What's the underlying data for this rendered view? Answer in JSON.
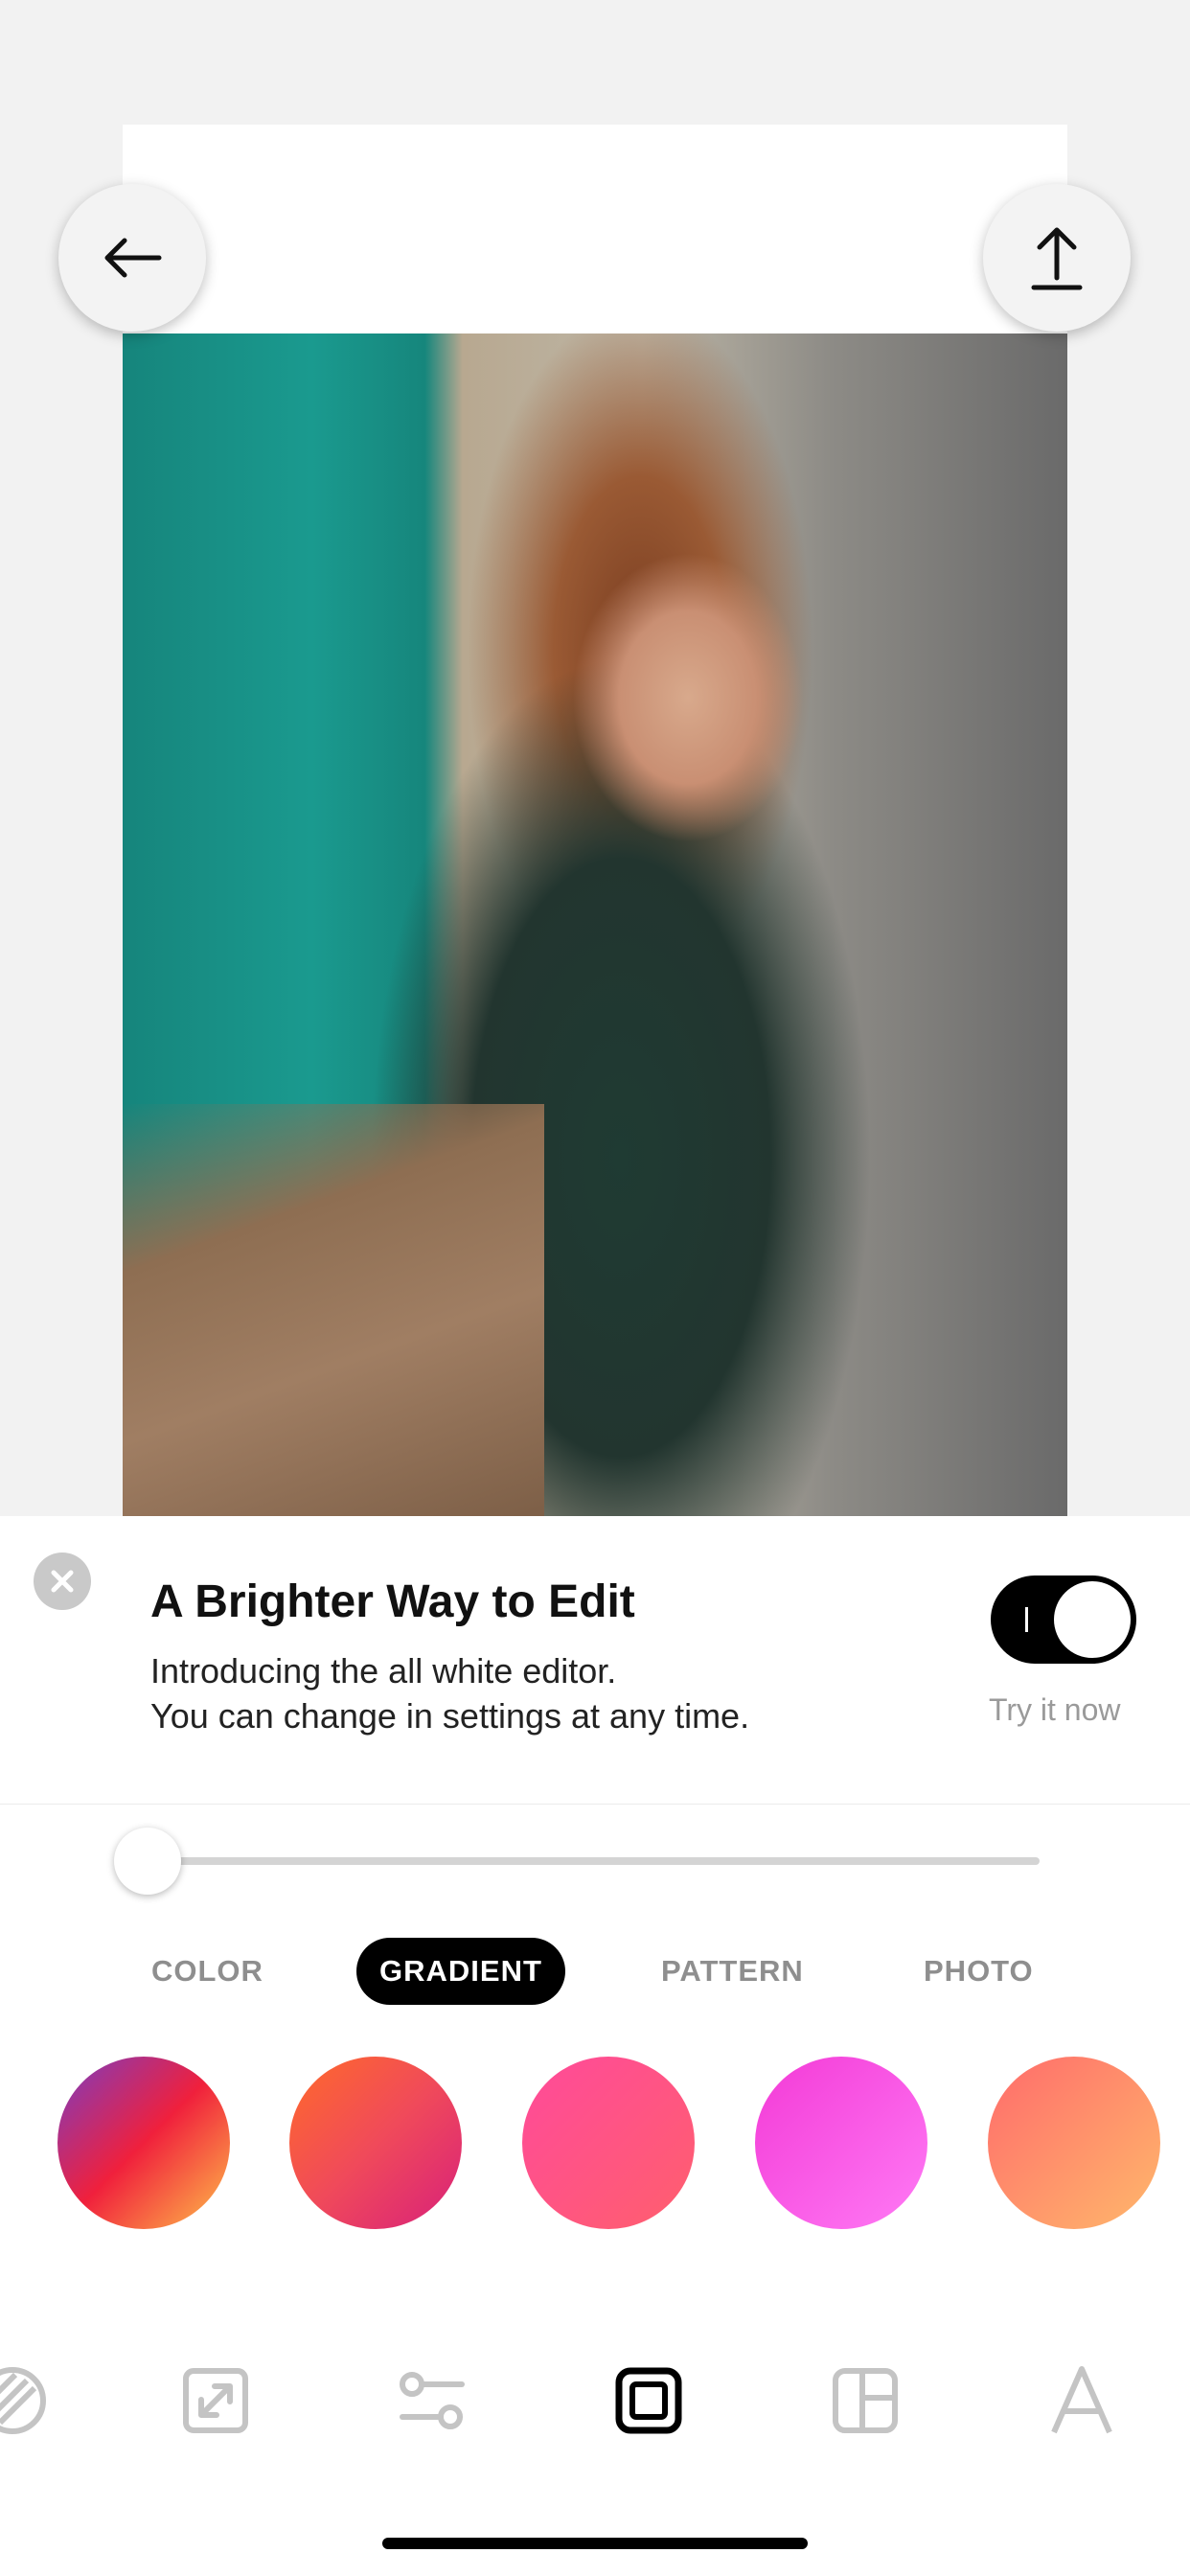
{
  "header": {
    "back_icon": "arrow-left-icon",
    "share_icon": "share-upload-icon"
  },
  "banner": {
    "title": "A Brighter Way to Edit",
    "line1": "Introducing the all white editor.",
    "line2": "You can change in settings at any time.",
    "toggle_on": true,
    "try_label": "Try it now"
  },
  "slider": {
    "value": 0
  },
  "tabs": [
    {
      "label": "COLOR",
      "active": false
    },
    {
      "label": "GRADIENT",
      "active": true
    },
    {
      "label": "PATTERN",
      "active": false
    },
    {
      "label": "PHOTO",
      "active": false
    }
  ],
  "swatches": [
    {
      "name": "purple-red-orange",
      "colors": [
        "#7b3dc2",
        "#f0203c",
        "#ffc04a"
      ]
    },
    {
      "name": "orange-magenta",
      "colors": [
        "#ff6a2a",
        "#d8207a"
      ]
    },
    {
      "name": "pink-coral",
      "colors": [
        "#ff4a9a",
        "#ff5f6d"
      ]
    },
    {
      "name": "magenta-pink",
      "colors": [
        "#f33ad6",
        "#ff7af5"
      ]
    },
    {
      "name": "coral-peach",
      "colors": [
        "#ff6b6b",
        "#ffb86b"
      ]
    }
  ],
  "toolbar": [
    {
      "icon": "filter-icon",
      "active": false
    },
    {
      "icon": "resize-icon",
      "active": false
    },
    {
      "icon": "adjust-icon",
      "active": false
    },
    {
      "icon": "border-icon",
      "active": true
    },
    {
      "icon": "layout-icon",
      "active": false
    },
    {
      "icon": "text-icon",
      "active": false
    }
  ],
  "colors": {
    "accent": "#000000",
    "inactive_tab": "#8e8e8e",
    "inactive_icon": "#bdbdbd"
  }
}
